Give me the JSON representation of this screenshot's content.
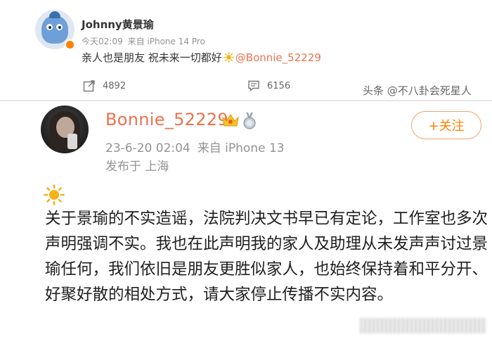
{
  "post1": {
    "username": "Johnny黄景瑜",
    "time": "今天02:09",
    "source": "来自 iPhone 14 Pro",
    "text": "亲人也是朋友 祝未来一切都好",
    "mention": "@Bonnie_52229",
    "share_count": "4892",
    "comment_count": "6156",
    "icons": [
      "avatar",
      "verified-badge-icon",
      "sun-icon",
      "share-icon",
      "comment-icon"
    ]
  },
  "watermark": "头条 @不八卦会死星人",
  "post2": {
    "username": "Bonnie_52229",
    "time": "23-6-20 02:04",
    "source": "来自 iPhone 13",
    "location": "发布于 上海",
    "follow_label": "+关注",
    "text": "关于景瑜的不实造谣，法院判决文书早已有定论，工作室也多次声明强调不实。我也在此声明我的家人及助理从未发声声讨过景瑜任何，我们依旧是朋友更胜似家人，也始终保持着和平分开、好聚好散的相处方式，请大家停止传播不实内容。",
    "icons": [
      "avatar",
      "crown-icon",
      "medal-icon",
      "sun-icon"
    ]
  },
  "colors": {
    "accent": "#ff8200",
    "mention": "#eb7350",
    "meta": "#939393"
  }
}
